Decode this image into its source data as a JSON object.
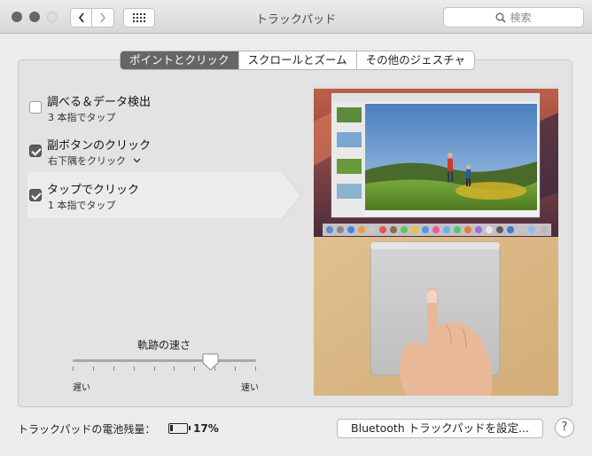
{
  "window": {
    "title": "トラックパッド",
    "search_placeholder": "検索"
  },
  "tabs": [
    {
      "label": "ポイントとクリック",
      "active": true
    },
    {
      "label": "スクロールとズーム",
      "active": false
    },
    {
      "label": "その他のジェスチャ",
      "active": false
    }
  ],
  "options": [
    {
      "title": "調べる＆データ検出",
      "subtitle": "3 本指でタップ",
      "checked": false
    },
    {
      "title": "副ボタンのクリック",
      "subtitle": "右下隅をクリック",
      "checked": true,
      "has_dropdown": true
    },
    {
      "title": "タップでクリック",
      "subtitle": "1 本指でタップ",
      "checked": true,
      "selected": true
    }
  ],
  "tracking": {
    "label": "軌跡の速さ",
    "min_label": "遅い",
    "max_label": "速い",
    "value_fraction": 0.75
  },
  "footer": {
    "battery_label": "トラックパッドの電池残量：",
    "battery_percent": "17%",
    "battery_value": 0.17,
    "bluetooth_button": "Bluetooth トラックパッドを設定...",
    "help_button": "?"
  },
  "colors": {
    "selected_tab": "#666666",
    "checkbox_checked": "#5f5f5f"
  }
}
